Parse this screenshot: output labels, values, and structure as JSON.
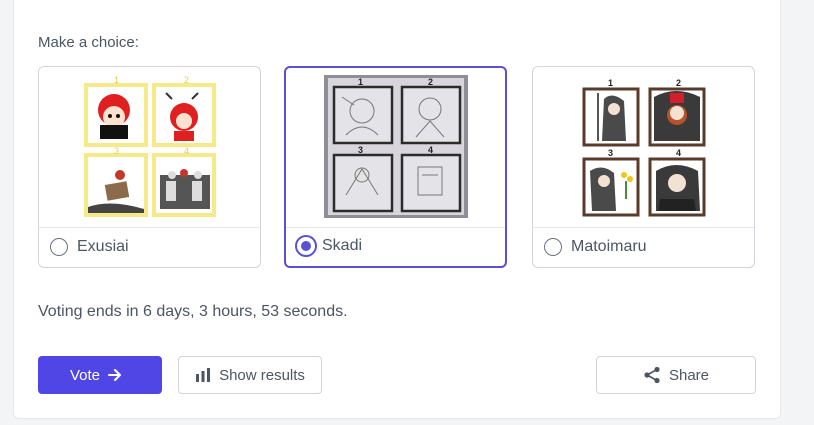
{
  "poll": {
    "prompt": "Make a choice:",
    "options": [
      {
        "label": "Exusiai",
        "selected": false
      },
      {
        "label": "Skadi",
        "selected": true
      },
      {
        "label": "Matoimaru",
        "selected": false
      }
    ],
    "voting_ends": "Voting ends in 6 days, 3 hours, 53 seconds."
  },
  "actions": {
    "vote_label": "Vote",
    "results_label": "Show results",
    "share_label": "Share"
  },
  "colors": {
    "accent": "#4f46e5",
    "selected_border": "#5b4fd6"
  },
  "thumbnail_numbers": [
    "1",
    "2",
    "3",
    "4"
  ]
}
